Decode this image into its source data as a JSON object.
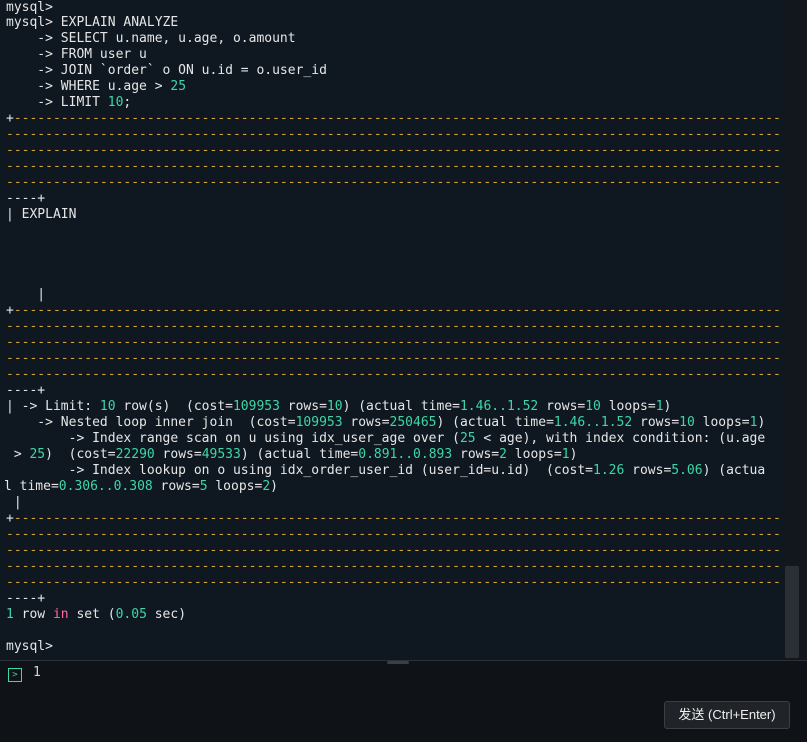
{
  "terminal": {
    "line_01": "mysql>",
    "line_02": "mysql> EXPLAIN ANALYZE",
    "line_03": "    -> SELECT u.name, u.age, o.amount",
    "line_04": "    -> FROM user u",
    "line_05": "    -> JOIN `order` o ON u.id = o.user_id",
    "line_06a": "    -> WHERE u.age > ",
    "line_06b": "25",
    "line_07a": "    -> LIMIT ",
    "line_07b": "10",
    "line_07c": ";",
    "border_top_plus": "+",
    "dash_long": "---------------------------------------------------------------------------------------------------",
    "dash_tail": "----+",
    "explain_header": "| EXPLAIN",
    "empty_pipe": "    |",
    "row_prefix": "| -> Limit: ",
    "row_limit_10": "10",
    "row_limit_after": " row(s)  (cost=",
    "row_limit_cost": "109953",
    "row_limit_rows_label": " rows=",
    "row_limit_rows": "10",
    "row_limit_actual": ") (actual time=",
    "row_limit_time": "1.46..1.52",
    "row_limit_rows2_label": " rows=",
    "row_limit_rows2": "10",
    "row_limit_loops_label": " loops=",
    "row_limit_loops": "1",
    "row_limit_end": ")",
    "nested_prefix": "    -> Nested loop inner join  (cost=",
    "nested_cost": "109953",
    "nested_rows_label": " rows=",
    "nested_rows": "250465",
    "nested_actual": ") (actual time=",
    "nested_time": "1.46..1.52",
    "nested_rows2_label": " rows=",
    "nested_rows2": "10",
    "nested_loops_label": " loops=",
    "nested_loops": "1",
    "nested_end": ")",
    "index_prefix": "        -> Index range scan on u using idx_user_age over (",
    "index_25": "25",
    "index_mid": " < age), with index condition: (u.age",
    "index2_prefix": " > ",
    "index2_25": "25",
    "index2_cost_label": ")  (cost=",
    "index2_cost": "22290",
    "index2_rows_label": " rows=",
    "index2_rows": "49533",
    "index2_actual": ") (actual time=",
    "index2_time": "0.891..0.893",
    "index2_rows2_label": " rows=",
    "index2_rows2": "2",
    "index2_loops_label": " loops=",
    "index2_loops": "1",
    "index2_end": ")",
    "lookup_prefix": "        -> Index lookup on o using idx_order_user_id (user_id=u.id)  (cost=",
    "lookup_cost": "1.26",
    "lookup_rows_label": " rows=",
    "lookup_rows": "5.06",
    "lookup_actual": ") (actua",
    "lookup2_prefix": "l time=",
    "lookup2_time": "0.306..0.308",
    "lookup2_rows_label": " rows=",
    "lookup2_rows": "5",
    "lookup2_loops_label": " loops=",
    "lookup2_loops": "2",
    "lookup2_end": ")",
    "pipe_only": " |",
    "result_1": "1",
    "result_row": " row ",
    "result_in": "in",
    "result_set": " set (",
    "result_time": "0.05",
    "result_end": " sec)",
    "final_prompt": "mysql>"
  },
  "input": {
    "value": "1",
    "prompt_icon": "terminal-prompt-icon"
  },
  "send_button": {
    "label": "发送 (Ctrl+Enter)"
  },
  "colors": {
    "background": "#0f1720",
    "text": "#e6e6e6",
    "number": "#3fd6a8",
    "keyword": "#ff6b9a",
    "dash": "#d7a635"
  }
}
